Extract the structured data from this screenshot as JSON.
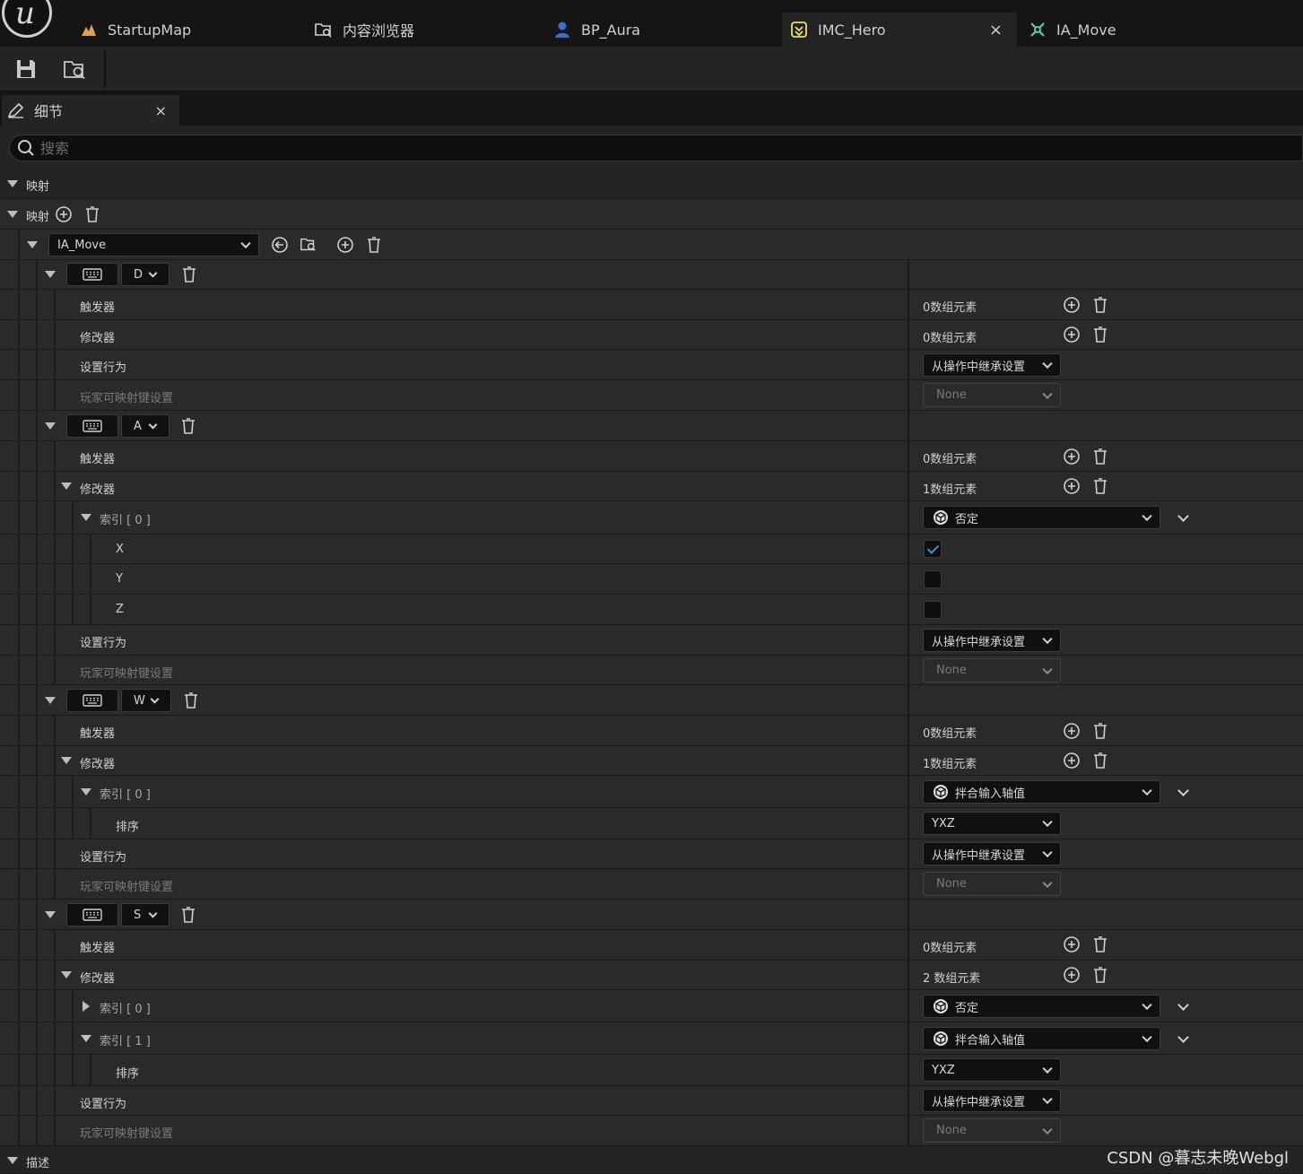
{
  "tabs": [
    {
      "label": "StartupMap",
      "icon": "map-icon"
    },
    {
      "label": "内容浏览器",
      "icon": "content-browser-icon"
    },
    {
      "label": "BP_Aura",
      "icon": "blueprint-icon"
    },
    {
      "label": "IMC_Hero",
      "icon": "input-mapping-context-icon",
      "active": true
    },
    {
      "label": "IA_Move",
      "icon": "input-action-icon"
    }
  ],
  "panel": {
    "title": "细节",
    "close": "×"
  },
  "search": {
    "placeholder": "搜索"
  },
  "sections": {
    "mappings_header": "映射",
    "mappings_array": "映射",
    "description": "描述"
  },
  "action": {
    "name": "IA_Move"
  },
  "labels": {
    "triggers": "触发器",
    "modifiers": "修改器",
    "settings_behavior": "设置行为",
    "player_mappable": "玩家可映射键设置",
    "sort": "排序",
    "x": "X",
    "y": "Y",
    "z": "Z",
    "inherit": "从操作中继承设置",
    "none": "None",
    "zero_elements": "0数组元素",
    "one_element": "1数组元素",
    "two_elements": "2 数组元素"
  },
  "mappings": [
    {
      "key": "D"
    },
    {
      "key": "A",
      "modifier0": "否定",
      "index0": "索引 [ 0 ]",
      "x_checked": true,
      "y_checked": false,
      "z_checked": false
    },
    {
      "key": "W",
      "modifier0": "拌合输入轴值",
      "index0": "索引 [ 0 ]",
      "order": "YXZ"
    },
    {
      "key": "S",
      "modifier0": "否定",
      "modifier1": "拌合输入轴值",
      "index0": "索引 [ 0 ]",
      "index1": "索引 [ 1 ]",
      "order": "YXZ"
    }
  ],
  "colors": {
    "background": "#2a2a2a",
    "accent": "#3c8fe0",
    "tab_map": "#e8a13a",
    "tab_imc": "#e8e26a",
    "tab_ia": "#5fd3b8",
    "tab_bp": "#3a6fd8"
  },
  "watermark": "CSDN @暮志未晚Webgl"
}
